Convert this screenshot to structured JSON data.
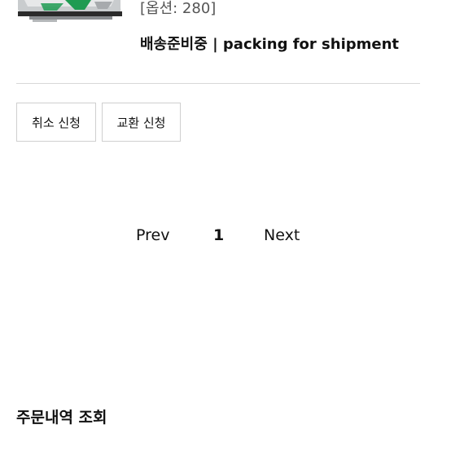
{
  "order_item": {
    "option_text": "[옵션: 280]",
    "status_text": "배송준비중 | packing for shipment"
  },
  "actions": {
    "cancel_label": "취소 신청",
    "exchange_label": "교환 신청"
  },
  "pagination": {
    "prev_label": "Prev",
    "current_page": "1",
    "next_label": "Next"
  },
  "section": {
    "title": "주문내역 조회"
  },
  "colors": {
    "text": "#111111",
    "border": "#cfcfcf",
    "divider": "#d8d8d8",
    "shoe_green": "#1f9b52",
    "shoe_silver": "#c9ccce"
  }
}
